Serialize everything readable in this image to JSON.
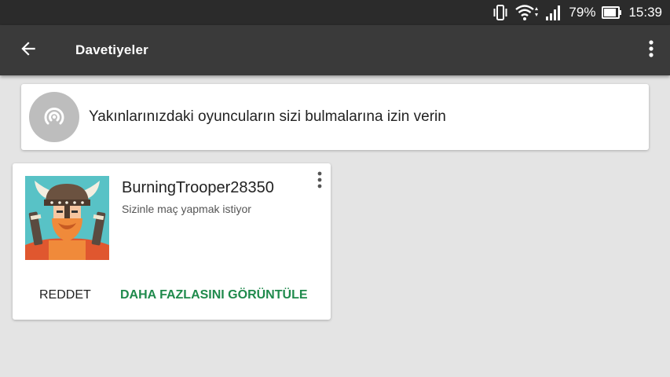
{
  "status_bar": {
    "battery_percent": "79%",
    "time": "15:39"
  },
  "app_bar": {
    "title": "Davetiyeler",
    "back_icon": "arrow-back-icon",
    "menu_icon": "more-vert-icon"
  },
  "nearby_banner": {
    "text": "Yakınlarınızdaki oyuncuların sizi bulmalarına izin verin",
    "icon": "nearby-signal-icon"
  },
  "invitations": [
    {
      "player_name": "BurningTrooper28350",
      "status": "Sizinle maç yapmak istiyor",
      "avatar": "viking-warrior-avatar",
      "decline_label": "REDDET",
      "view_more_label": "DAHA FAZLASINI GÖRÜNTÜLE"
    }
  ],
  "colors": {
    "status_bar_bg": "#2b2b2b",
    "app_bar_bg": "#3a3a3a",
    "page_bg": "#e4e4e4",
    "accent_green": "#1f8a4c",
    "avatar_bg": "#58c2c6"
  }
}
